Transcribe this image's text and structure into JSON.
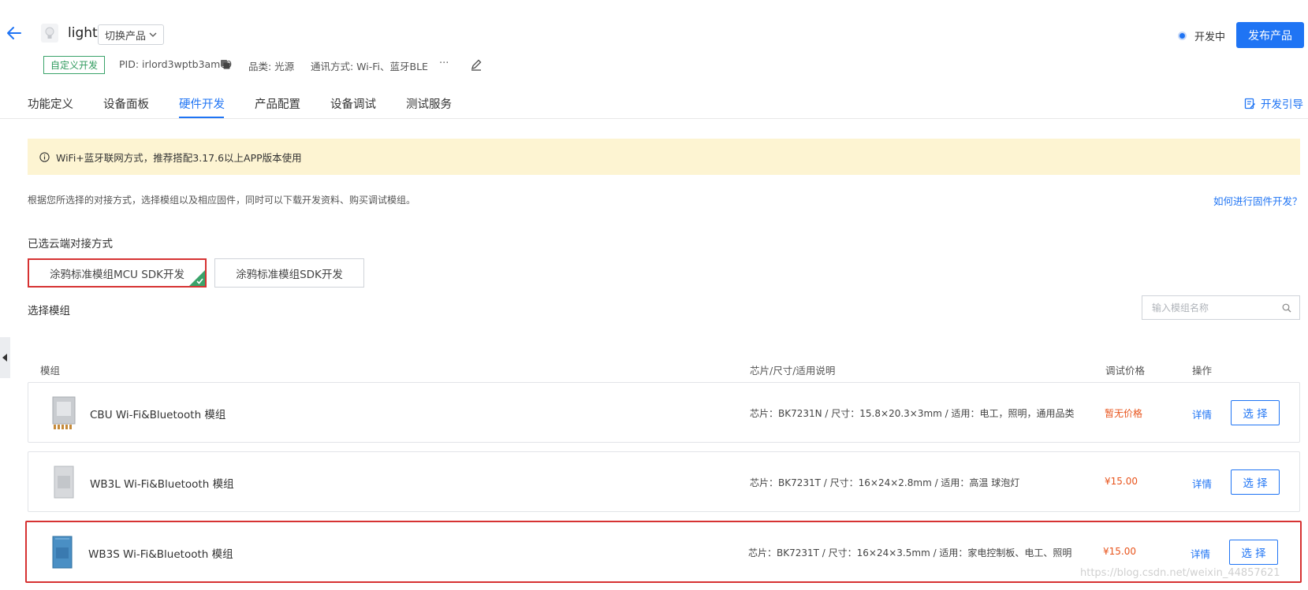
{
  "header": {
    "product_name": "light",
    "switch_label": "切换产品",
    "custom_tag": "自定义开发",
    "pid": "PID: irlord3wptb3amc9",
    "category": "品类: 光源",
    "comm": "通讯方式: Wi-Fi、蓝牙BLE",
    "more": "···",
    "status": "开发中",
    "publish_label": "发布产品"
  },
  "tabs": [
    {
      "label": "功能定义"
    },
    {
      "label": "设备面板"
    },
    {
      "label": "硬件开发"
    },
    {
      "label": "产品配置"
    },
    {
      "label": "设备调试"
    },
    {
      "label": "测试服务"
    }
  ],
  "guide_label": "开发引导",
  "notice": "WiFi+蓝牙联网方式，推荐搭配3.17.6以上APP版本使用",
  "description": "根据您所选择的对接方式，选择模组以及相应固件，同时可以下载开发资料、购买调试模组。",
  "how_link": "如何进行固件开发？",
  "cloud_section": "已选云端对接方式",
  "sdk_options": [
    {
      "label": "涂鸦标准模组MCU SDK开发"
    },
    {
      "label": "涂鸦标准模组SDK开发"
    }
  ],
  "module_section": "选择模组",
  "search": {
    "placeholder": "输入模组名称"
  },
  "columns": {
    "module": "模组",
    "spec": "芯片/尺寸/适用说明",
    "price": "调试价格",
    "action": "操作"
  },
  "modules": [
    {
      "name": "CBU Wi-Fi&Bluetooth 模组",
      "spec": "芯片：BK7231N / 尺寸：15.8×20.3×3mm / 适用：电工，照明，通用品类",
      "price": "暂无价格",
      "detail": "详情",
      "select": "选 择"
    },
    {
      "name": "WB3L Wi-Fi&Bluetooth 模组",
      "spec": "芯片：BK7231T / 尺寸：16×24×2.8mm / 适用：高温 球泡灯",
      "price": "¥15.00",
      "detail": "详情",
      "select": "选 择"
    },
    {
      "name": "WB3S Wi-Fi&Bluetooth 模组",
      "spec": "芯片：BK7231T / 尺寸：16×24×3.5mm / 适用：家电控制板、电工、照明",
      "price": "¥15.00",
      "detail": "详情",
      "select": "选 择"
    }
  ],
  "watermark": "https://blog.csdn.net/weixin_44857621",
  "colors": {
    "accent": "#1f74f4",
    "price": "#e8541c",
    "success": "#3aa36a",
    "highlight": "#d63232",
    "notice_bg": "#fdf4d2"
  }
}
